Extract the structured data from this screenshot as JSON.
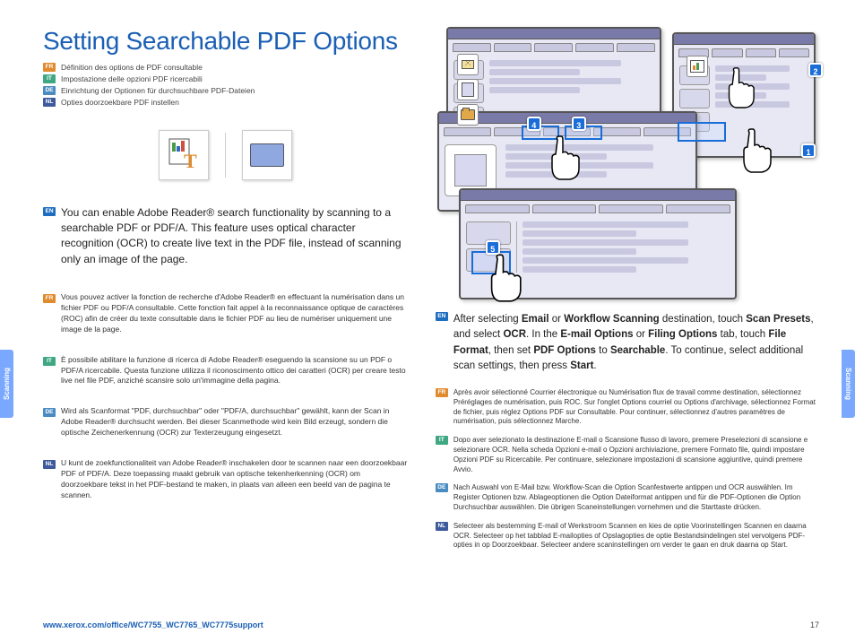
{
  "title": "Setting Searchable PDF Options",
  "title_langs": {
    "fr": "Définition des options de PDF consultable",
    "it": "Impostazione delle opzioni PDF ricercabili",
    "de": "Einrichtung der Optionen für durchsuchbare PDF-Dateien",
    "nl": "Opties doorzoekbare PDF instellen"
  },
  "left_main": "You can enable Adobe Reader® search functionality by scanning to a searchable PDF or PDF/A. This feature uses optical character recognition (OCR) to create live text in the PDF file, instead of scanning only an image of the page.",
  "left_subs": {
    "fr": "Vous pouvez activer la fonction de recherche d'Adobe Reader® en effectuant la numérisation dans un fichier PDF ou PDF/A consultable. Cette fonction fait appel à la reconnaissance optique de caractères (ROC) afin de créer du texte consultable dans le fichier PDF au lieu de numériser uniquement une image de la page.",
    "it": "È possibile abilitare la funzione di ricerca di Adobe Reader® eseguendo la scansione su un PDF o PDF/A ricercabile. Questa funzione utilizza il riconoscimento ottico dei caratteri (OCR) per creare testo live nel file PDF, anziché scansire solo un'immagine della pagina.",
    "de": "Wird als Scanformat \"PDF, durchsuchbar\" oder \"PDF/A, durchsuchbar\" gewählt, kann der Scan in Adobe Reader® durchsucht werden. Bei dieser Scanmethode wird kein Bild erzeugt, sondern die optische Zeichenerkennung (OCR) zur Texterzeugung eingesetzt.",
    "nl": "U kunt de zoekfunctionaliteit van Adobe Reader® inschakelen door te scannen naar een doorzoekbaar PDF of PDF/A. Deze toepassing maakt gebruik van optische tekenherkenning (OCR) om doorzoekbare tekst in het PDF-bestand te maken, in plaats van alleen een beeld van de pagina te scannen."
  },
  "right_main_parts": [
    "After selecting ",
    "Email",
    " or ",
    "Workflow Scanning",
    " destination, touch ",
    "Scan Presets",
    ", and select ",
    "OCR",
    ". In the ",
    "E-mail Options",
    " or ",
    "Filing Options",
    " tab, touch ",
    "File Format",
    ", then set ",
    "PDF Options",
    " to ",
    "Searchable",
    ". To continue, select additional scan settings, then press ",
    "Start",
    "."
  ],
  "right_subs": {
    "fr": "Après avoir sélectionné Courrier électronique ou Numérisation flux de travail comme destination, sélectionnez Préréglages de numérisation, puis ROC. Sur l'onglet Options courriel ou Options d'archivage, sélectionnez Format de fichier, puis réglez Options PDF sur Consultable. Pour continuer, sélectionnez d'autres paramètres de numérisation, puis sélectionnez Marche.",
    "it": "Dopo aver selezionato la destinazione E-mail o Scansione flusso di lavoro, premere Preselezioni di scansione e selezionare OCR. Nella scheda Opzioni e-mail o Opzioni archiviazione, premere Formato file, quindi impostare Opzioni PDF su Ricercabile. Per continuare, selezionare impostazioni di scansione aggiuntive, quindi premere Avvio.",
    "de": "Nach Auswahl von E-Mail bzw. Workflow-Scan die Option Scanfestwerte antippen und OCR auswählen. Im Register Optionen bzw. Ablageoptionen die Option Dateiformat antippen und für die PDF-Optionen die Option Durchsuchbar auswählen. Die übrigen Scaneinstellungen vornehmen und die Starttaste drücken.",
    "nl": "Selecteer als bestemming E-mail of Werkstroom Scannen en kies de optie Voorinstellingen Scannen en daarna OCR. Selecteer op het tabblad E-mailopties of Opslagopties de optie Bestandsindelingen stel vervolgens PDF-opties in op Doorzoekbaar. Selecteer andere scaninstellingen om verder te gaan en druk daarna op Start."
  },
  "side_tab": "Scanning",
  "footer_url": "www.xerox.com/office/WC7755_WC7765_WC7775support",
  "page_num": "17",
  "callouts": {
    "1": "1",
    "2": "2",
    "3": "3",
    "4": "4",
    "5": "5"
  }
}
